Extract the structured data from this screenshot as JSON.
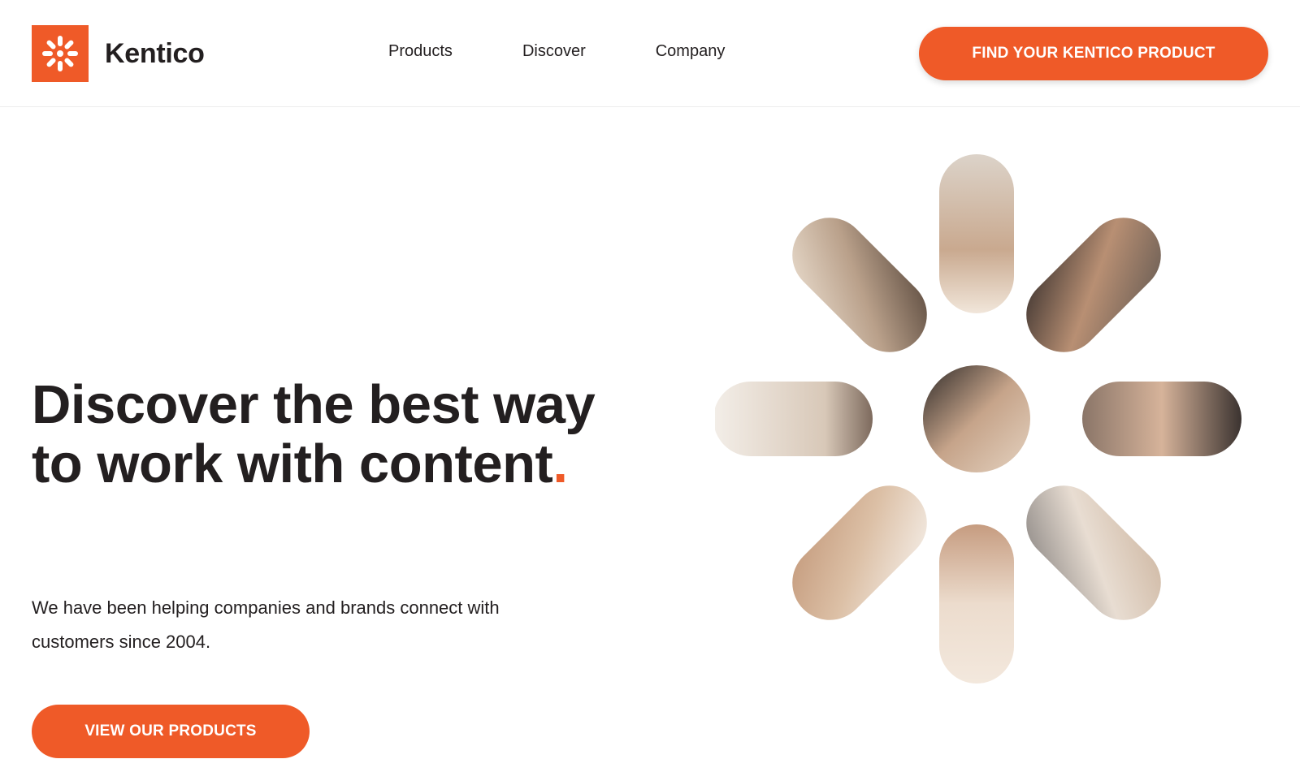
{
  "header": {
    "brand": "Kentico",
    "logo_icon": "kentico-asterisk-logo",
    "nav": [
      {
        "label": "Products"
      },
      {
        "label": "Discover"
      },
      {
        "label": "Company"
      }
    ],
    "cta_label": "FIND YOUR KENTICO PRODUCT"
  },
  "hero": {
    "title_main": "Discover the best way to work with content",
    "title_dot": ".",
    "subtitle": "We have been helping companies and brands connect with customers since 2004.",
    "cta_label": "VIEW OUR PRODUCTS"
  },
  "colors": {
    "accent": "#ef5a28",
    "text": "#231f20"
  }
}
